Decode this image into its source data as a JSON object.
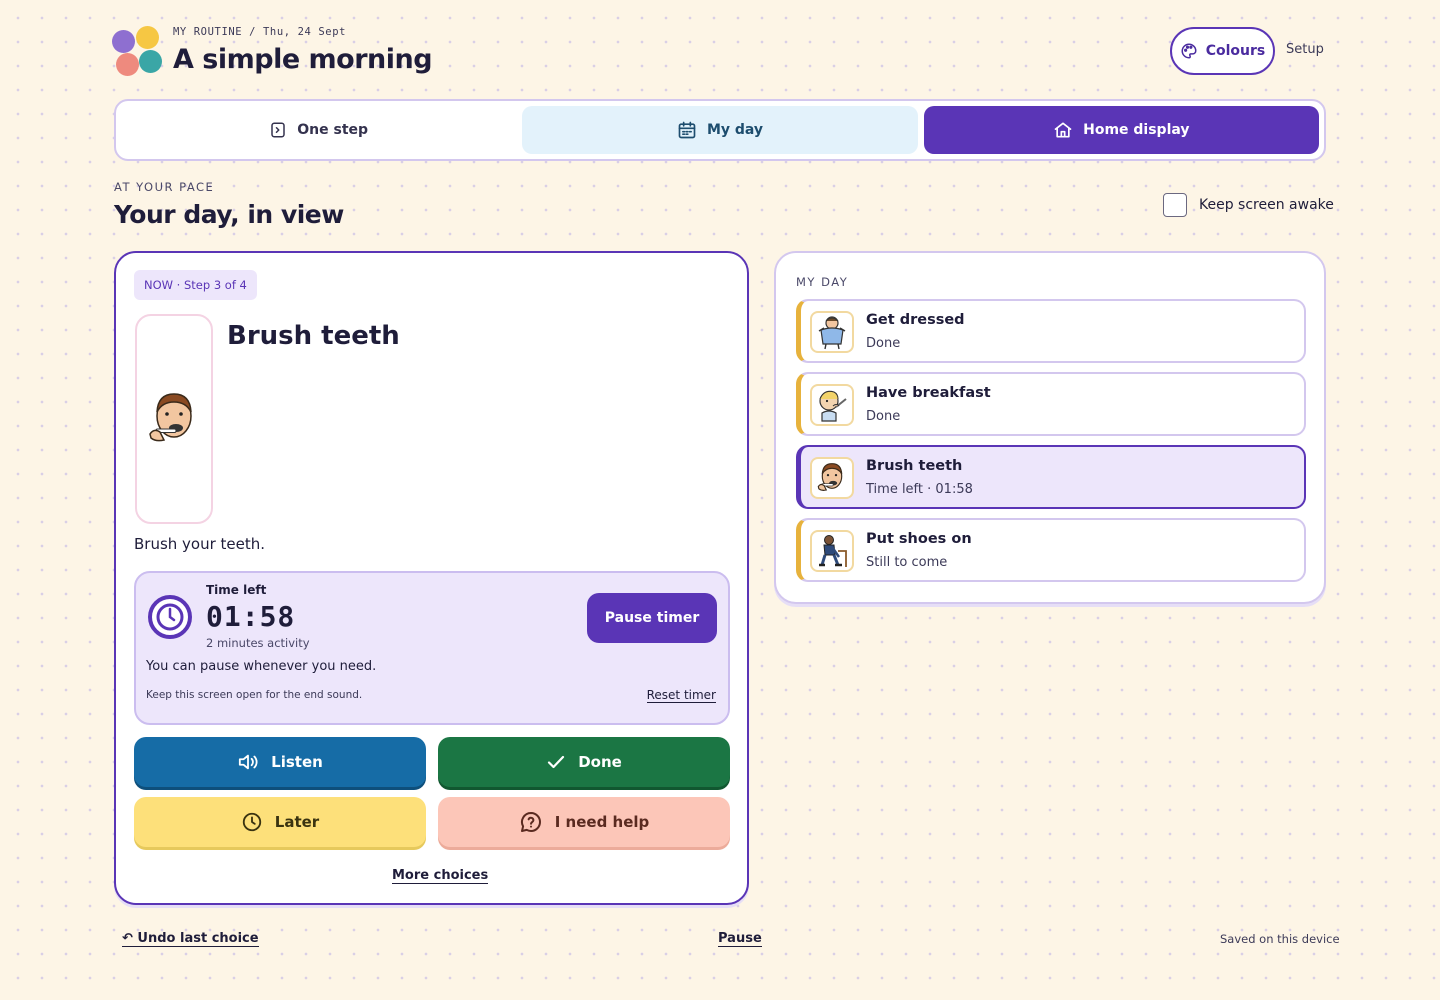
{
  "header": {
    "breadcrumb": "MY ROUTINE / Thu, 24 Sept",
    "title": "A simple morning",
    "colours_label": "Colours",
    "setup_label": "Setup"
  },
  "tabs": [
    {
      "label": "One step",
      "icon": "step-icon"
    },
    {
      "label": "My day",
      "icon": "calendar-icon"
    },
    {
      "label": "Home display",
      "icon": "home-icon",
      "selected": true
    }
  ],
  "section": {
    "eyebrow": "AT YOUR PACE",
    "title": "Your day, in view",
    "keep_awake_label": "Keep screen awake",
    "keep_awake_checked": false
  },
  "current_step": {
    "badge": "NOW · Step 3 of 4",
    "title": "Brush teeth",
    "description": "Brush your teeth.",
    "timer": {
      "label": "Time left",
      "value": "01:58",
      "sub": "2 minutes activity",
      "pause_label": "Pause timer",
      "pause_note": "You can pause whenever you need.",
      "keep_note": "Keep this screen open for the end sound.",
      "reset_label": "Reset timer"
    },
    "actions": {
      "listen": "Listen",
      "done": "Done",
      "later": "Later",
      "help": "I need help"
    },
    "more_label": "More choices"
  },
  "my_day": {
    "heading": "MY DAY",
    "items": [
      {
        "name": "Get dressed",
        "status": "Done",
        "icon": "get-dressed-icon"
      },
      {
        "name": "Have breakfast",
        "status": "Done",
        "icon": "breakfast-icon"
      },
      {
        "name": "Brush teeth",
        "status": "Time left · 01:58",
        "icon": "brush-teeth-icon",
        "current": true
      },
      {
        "name": "Put shoes on",
        "status": "Still to come",
        "icon": "shoes-icon"
      }
    ]
  },
  "footer": {
    "undo_label": "↶ Undo last choice",
    "pause_label": "Pause",
    "saved_label": "Saved on this device"
  },
  "colors": {
    "accent": "#5a35b6",
    "listen": "#166ca6",
    "done": "#1b7644",
    "later": "#fde07a",
    "help": "#fcc6b8"
  }
}
